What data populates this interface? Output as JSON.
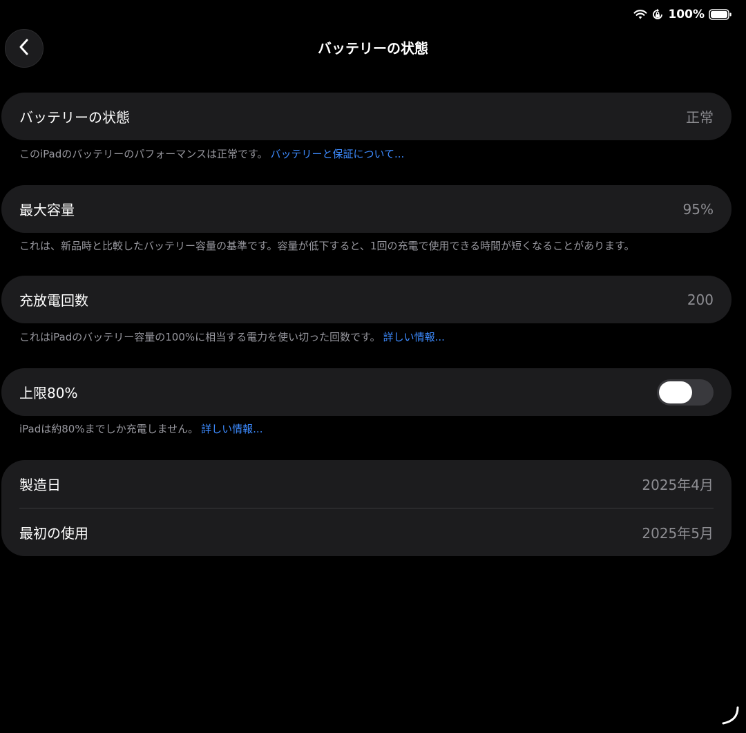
{
  "status_bar": {
    "battery_percent": "100%",
    "battery_level": 1.0,
    "icons": [
      "wifi-icon",
      "orientation-lock-icon",
      "battery-icon"
    ]
  },
  "nav": {
    "back_icon": "chevron-left-icon",
    "title": "バッテリーの状態"
  },
  "health": {
    "label": "バッテリーの状態",
    "value": "正常",
    "footnote": "このiPadのバッテリーのパフォーマンスは正常です。",
    "link": "バッテリーと保証について..."
  },
  "capacity": {
    "label": "最大容量",
    "value": "95%",
    "footnote": "これは、新品時と比較したバッテリー容量の基準です。容量が低下すると、1回の充電で使用できる時間が短くなることがあります。"
  },
  "cycles": {
    "label": "充放電回数",
    "value": "200",
    "footnote": "これはiPadのバッテリー容量の100%に相当する電力を使い切った回数です。",
    "link": "詳しい情報..."
  },
  "limit": {
    "label": "上限80%",
    "toggle_on": false,
    "footnote": "iPadは約80%までしか充電しません。",
    "link": "詳しい情報..."
  },
  "dates": {
    "manufactured_label": "製造日",
    "manufactured_value": "2025年4月",
    "first_use_label": "最初の使用",
    "first_use_value": "2025年5月"
  },
  "colors": {
    "background": "#000000",
    "card": "#1c1c1e",
    "secondary_text": "#8e8e93",
    "link": "#3d8bff"
  }
}
